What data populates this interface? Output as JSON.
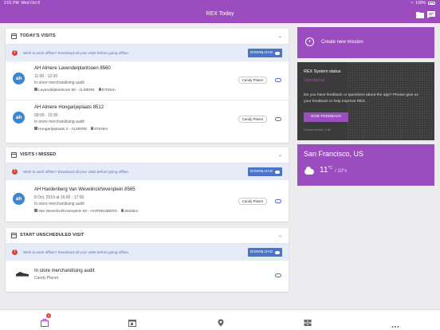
{
  "status_bar": {
    "time": "2:01 PM",
    "date": "Wed Oct 9",
    "battery": "100%"
  },
  "header": {
    "title": "REX Today"
  },
  "offline_notice": {
    "text": "Wish to work offline? Download all your visits before going offline.",
    "button": "DOWNLOAD"
  },
  "today": {
    "title": "TODAY'S VISITS",
    "visits": [
      {
        "name": "AH Almere Lavendelplantsoen 8560",
        "time": "11:00 - 12:30",
        "type": "In store merchandising audit",
        "address": "Lavendelplantsoen 60 - ALMERE",
        "distance": "8782km",
        "client": "Candy Planet"
      },
      {
        "name": "AH Almere Hongarijeplaats 8512",
        "time": "09:00 - 10:30",
        "type": "In store merchandising audit",
        "address": "Hongarijeplaats 2 - ALMERE",
        "distance": "8784km",
        "client": "Candy Planet"
      }
    ]
  },
  "missed": {
    "title": "VISITS I MISSED",
    "visits": [
      {
        "name": "AH Hardenberg Van Wevelinckhovenplein 8565",
        "time": "8 Oct, 2019 at 16:00 - 17:00",
        "type": "In store merchandising audit",
        "address": "Van Wevelinckhovenplein 60 - HARDENBERG",
        "distance": "8826km",
        "client": "Candy Planet"
      }
    ]
  },
  "unscheduled": {
    "title": "START UNSCHEDULED VISIT",
    "item": {
      "name": "In store merchandising audit",
      "client": "Candy Planet"
    }
  },
  "mission": {
    "label": "Create new mission"
  },
  "system_status": {
    "title": "REX System status",
    "subtitle": "Operational",
    "question": "Do you have feedback or questions about the app? Please give us your feedback to help improve REX.",
    "button": "GIVE FEEDBACK",
    "version": "Current version: 1.36"
  },
  "weather": {
    "city": "San Francisco, US",
    "temp": "11",
    "unit": "°C",
    "low": "/ 10°c"
  },
  "tabbar": {
    "badge": "3"
  },
  "colors": {
    "brand": "#9b4dc0",
    "accent_blue": "#4b74c8",
    "warning": "#e0413a"
  }
}
